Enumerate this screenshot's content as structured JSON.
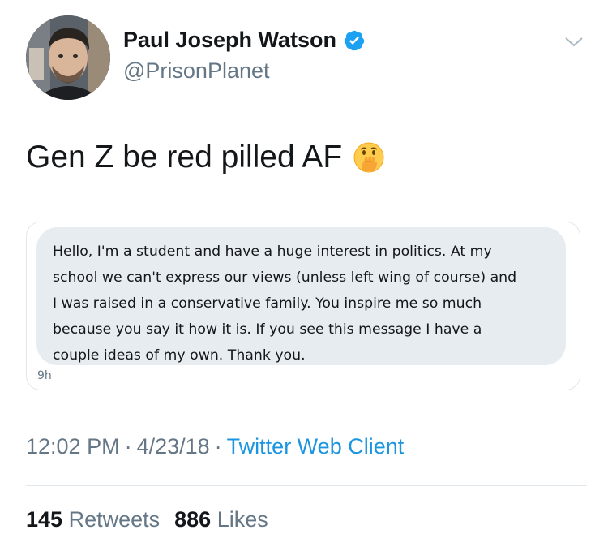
{
  "author": {
    "name": "Paul Joseph Watson",
    "handle": "@PrisonPlanet",
    "verified": true
  },
  "tweet": {
    "text": "Gen Z be red pilled AF",
    "emoji": "face-with-hand-over-mouth"
  },
  "quoted_message": {
    "lines": [
      "Hello, I'm a student and have a huge interest in politics. At my",
      "school we can't express our views (unless left wing of course) and",
      "I was raised in a conservative family. You inspire me so much",
      "because you say it how it is. If you see this message I have a",
      "couple ideas of my own. Thank you."
    ],
    "time": "9h"
  },
  "meta": {
    "time": "12:02 PM",
    "separator": "·",
    "date": "4/23/18",
    "client": "Twitter Web Client"
  },
  "stats": {
    "retweets_count": "145",
    "retweets_label": "Retweets",
    "likes_count": "886",
    "likes_label": "Likes"
  },
  "colors": {
    "text": "#14171a",
    "secondary": "#657786",
    "link": "#1b95e0",
    "bubble": "#e6ecf0",
    "border": "#e1e8ed",
    "verified": "#1da1f2"
  },
  "icons": {
    "verified": "verified-badge-icon",
    "menu": "chevron-down-icon"
  }
}
